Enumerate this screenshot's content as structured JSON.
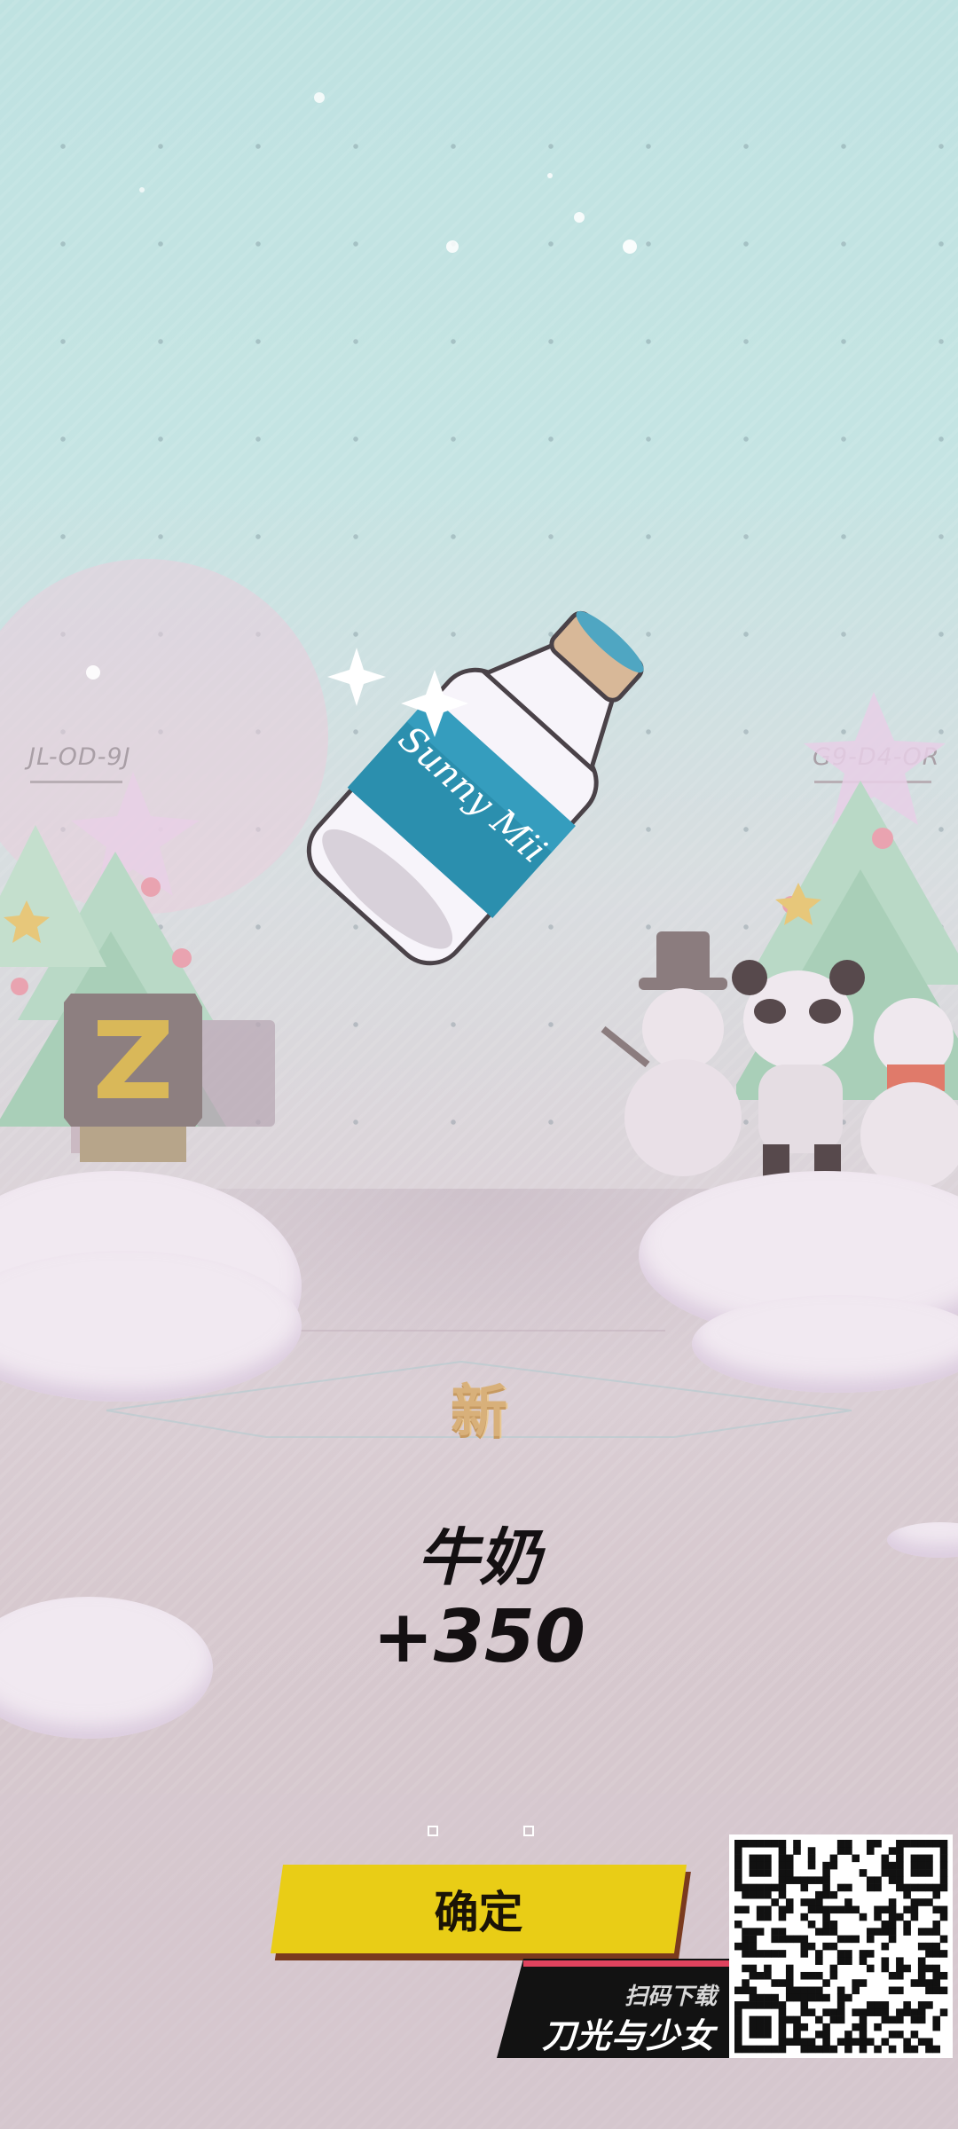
{
  "scene": {
    "left_code": "JL-OD-9J",
    "right_code": "G9-D4-OR"
  },
  "reward": {
    "new_tag": "新",
    "item_name": "牛奶",
    "item_count": "+350",
    "item_icon": "milk-bottle-icon",
    "bottle_label": "Sunny Mii"
  },
  "actions": {
    "confirm_label": "确定"
  },
  "download": {
    "scan_text": "扫码下载",
    "game_title": "刀光与少女",
    "qr_icon": "qr-code-icon"
  },
  "colors": {
    "confirm_button": "#e9cd16",
    "banner_accent": "#e0435e",
    "new_tag": "#d8b07a"
  }
}
